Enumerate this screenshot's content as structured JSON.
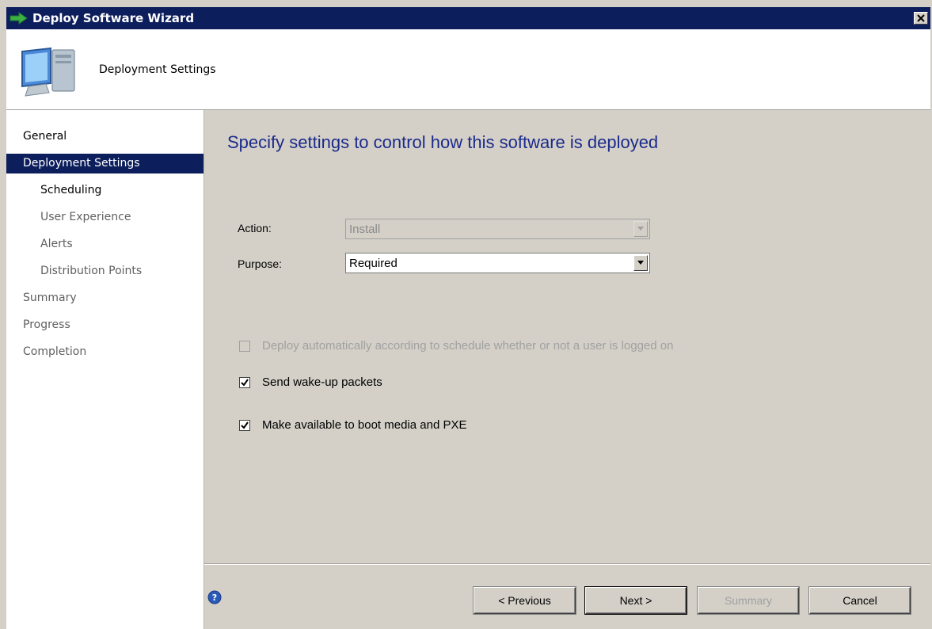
{
  "window": {
    "title": "Deploy Software Wizard"
  },
  "header": {
    "title": "Deployment Settings"
  },
  "sidebar": {
    "items": [
      {
        "label": "General"
      },
      {
        "label": "Deployment Settings"
      },
      {
        "label": "Scheduling"
      },
      {
        "label": "User Experience"
      },
      {
        "label": "Alerts"
      },
      {
        "label": "Distribution Points"
      },
      {
        "label": "Summary"
      },
      {
        "label": "Progress"
      },
      {
        "label": "Completion"
      }
    ],
    "selected": "Deployment Settings"
  },
  "main": {
    "heading": "Specify settings to control how this software is deployed",
    "action": {
      "label": "Action:",
      "value": "Install",
      "enabled": false
    },
    "purpose": {
      "label": "Purpose:",
      "value": "Required",
      "enabled": true
    },
    "options": [
      {
        "label": "Deploy automatically according to schedule whether or not a user is logged on",
        "checked": false,
        "enabled": false
      },
      {
        "label": "Send wake-up packets",
        "checked": true,
        "enabled": true
      },
      {
        "label": "Make available to boot media and PXE",
        "checked": true,
        "enabled": true
      }
    ]
  },
  "footer": {
    "previous": "< Previous",
    "next": "Next >",
    "summary": "Summary",
    "cancel": "Cancel"
  },
  "icons": {
    "title": "green-arrow-icon",
    "close": "close-icon",
    "header": "computer-icon",
    "help": "help-icon"
  },
  "colors": {
    "titlebar": "#0d1e5c",
    "selected_nav": "#0d1e5c",
    "heading": "#1a2a8a",
    "panel": "#d4d0c8"
  }
}
